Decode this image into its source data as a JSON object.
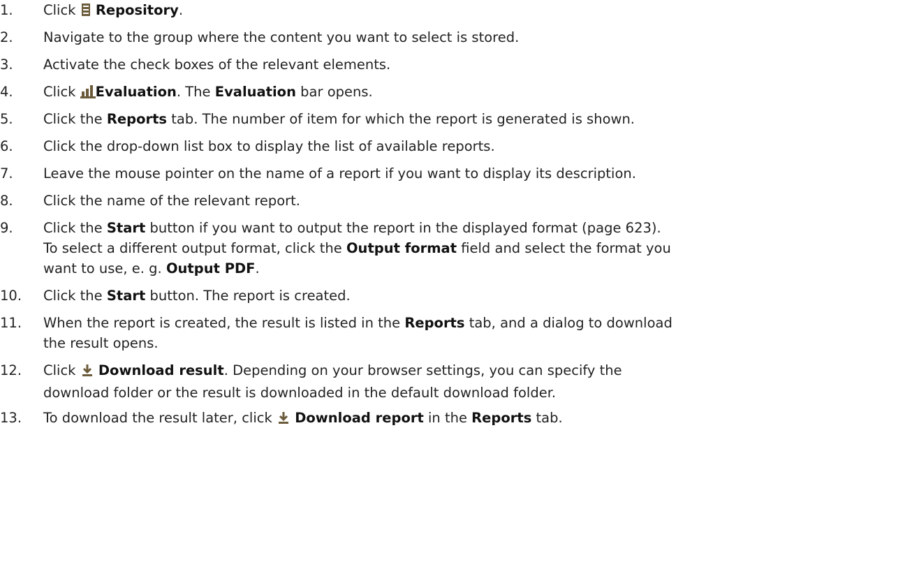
{
  "steps": [
    {
      "num": "1.",
      "t": [
        "Click ",
        " ",
        "Repository",
        "."
      ]
    },
    {
      "num": "2.",
      "t": [
        "Navigate to the group where the content you want to select is stored."
      ]
    },
    {
      "num": "3.",
      "t": [
        "Activate the check boxes of the relevant elements."
      ]
    },
    {
      "num": "4.",
      "t": [
        "Click ",
        "Evaluation",
        ". The ",
        "Evaluation",
        " bar opens."
      ]
    },
    {
      "num": "5.",
      "t": [
        "Click the ",
        "Reports",
        " tab. The number of item for which the report is generated is shown."
      ]
    },
    {
      "num": "6.",
      "t": [
        "Click the drop-down list box to display the list of available reports."
      ]
    },
    {
      "num": "7.",
      "t": [
        "Leave the mouse pointer on the name of a report if you want to display its description."
      ]
    },
    {
      "num": "8.",
      "t": [
        "Click the name of the relevant report."
      ]
    },
    {
      "num": "9.",
      "t": [
        "Click the ",
        "Start",
        " button if you want to output the report in the displayed format (page 623).",
        "To select a different output format, click the ",
        "Output format",
        " field and select the format you",
        "want to use, e. g. ",
        "Output PDF",
        "."
      ]
    },
    {
      "num": "10.",
      "t": [
        "Click the ",
        "Start",
        " button. The report is created."
      ]
    },
    {
      "num": "11.",
      "t": [
        "When the report is created, the result is listed in the ",
        "Reports",
        " tab, and a dialog to download",
        "the result opens."
      ]
    },
    {
      "num": "12.",
      "t": [
        "Click ",
        "Download result",
        ". Depending on your browser settings, you can specify the",
        "download folder or the result is downloaded in the default download folder."
      ]
    },
    {
      "num": "13.",
      "t": [
        "To download the result later, click ",
        "Download report",
        " in the ",
        "Reports",
        " tab."
      ]
    }
  ],
  "icons": {
    "repository": "repository-icon",
    "evaluation": "evaluation-icon",
    "download": "download-icon",
    "icon_color": "#6b5b3a"
  }
}
